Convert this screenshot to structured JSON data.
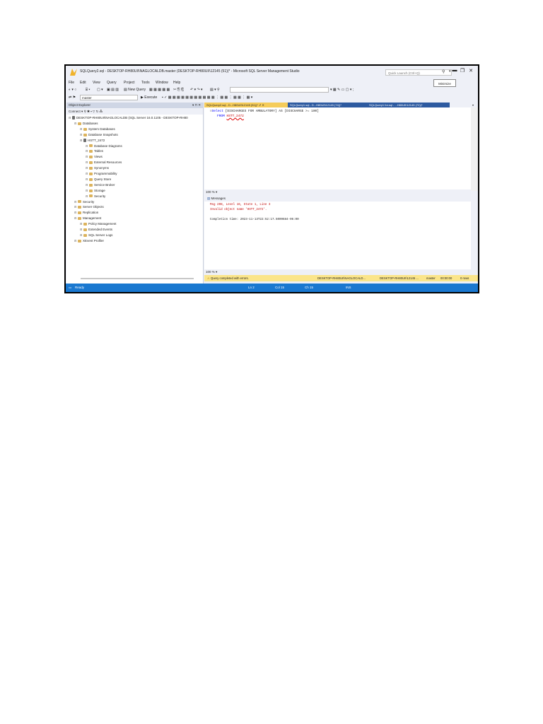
{
  "window": {
    "title": "SQLQuery2.sql - DESKTOP-RH80UII\\NAGLOCALDB.master (DESKTOP-RH80UII\\12145 (51))* - Microsoft SQL Server Management Studio",
    "quick_launch_placeholder": "Quick Launch (Ctrl+Q)",
    "minimize_tooltip": "Minimize"
  },
  "menu": [
    "File",
    "Edit",
    "View",
    "Query",
    "Project",
    "Tools",
    "Window",
    "Help"
  ],
  "toolbar": {
    "new_query": "New Query",
    "database": "master",
    "execute": "Execute"
  },
  "object_explorer": {
    "title": "Object Explorer",
    "title_controls": "▾ ⊓ ✕",
    "toolbar": "Connect ▾  ⚲  ✱  ▪  ▽  ↻  ⁂",
    "tree": [
      {
        "label": "DESKTOP-RH80UII\\NAGLOCALDB (SQL Server 16.0.1105 - DESKTOP-RH80",
        "level": 0,
        "kind": "server"
      },
      {
        "label": "Databases",
        "level": 1,
        "kind": "folder"
      },
      {
        "label": "System Databases",
        "level": 2,
        "kind": "folder"
      },
      {
        "label": "Database Snapshots",
        "level": 2,
        "kind": "folder"
      },
      {
        "label": "HSTT_2472",
        "level": 2,
        "kind": "db"
      },
      {
        "label": "Database Diagrams",
        "level": 3,
        "kind": "folder"
      },
      {
        "label": "Tables",
        "level": 3,
        "kind": "folder"
      },
      {
        "label": "Views",
        "level": 3,
        "kind": "folder"
      },
      {
        "label": "External Resources",
        "level": 3,
        "kind": "folder"
      },
      {
        "label": "Synonyms",
        "level": 3,
        "kind": "folder"
      },
      {
        "label": "Programmability",
        "level": 3,
        "kind": "folder"
      },
      {
        "label": "Query Store",
        "level": 3,
        "kind": "folder"
      },
      {
        "label": "Service Broker",
        "level": 3,
        "kind": "folder"
      },
      {
        "label": "Storage",
        "level": 3,
        "kind": "folder"
      },
      {
        "label": "Security",
        "level": 3,
        "kind": "folder"
      },
      {
        "label": "Security",
        "level": 1,
        "kind": "folder"
      },
      {
        "label": "Server Objects",
        "level": 1,
        "kind": "folder"
      },
      {
        "label": "Replication",
        "level": 1,
        "kind": "folder"
      },
      {
        "label": "Management",
        "level": 1,
        "kind": "folder"
      },
      {
        "label": "Policy Management",
        "level": 2,
        "kind": "folder"
      },
      {
        "label": "Extended Events",
        "level": 2,
        "kind": "folder"
      },
      {
        "label": "SQL Server Logs",
        "level": 2,
        "kind": "folder"
      },
      {
        "label": "XEvent Profiler",
        "level": 1,
        "kind": "folder"
      }
    ]
  },
  "tabs": [
    {
      "label": "SQLQuery2.sql - D...H80UII\\12145 (51))*",
      "active": true,
      "close": "⇗ ✕"
    },
    {
      "label": "SQLQuery1.sql - D...H80UII\\12145 (74))*",
      "active": false
    },
    {
      "label": "SQLQuery1 for.sql - ...H80UII\\12145 (72))*",
      "active": false
    }
  ],
  "editor": {
    "line1_keyword": "Select",
    "line1_rest": "[DISCHARGES FOR AMBULATORY] AS [DISCHARGE >= 100]",
    "line2_keyword": "FROM",
    "line2_table": "HSTT_2472"
  },
  "zoom": "100 %",
  "messages": {
    "header": "Messages",
    "error_line1": "Msg 208, Level 16, State 1, Line 3",
    "error_line2": "Invalid object name 'HSTT_2472'.",
    "completion": "Completion time: 2023-11-13T22:52:17.5009684-06:00"
  },
  "query_status": {
    "text": "Query completed with errors.",
    "server": "DESKTOP-RH80UII\\NAGLOCALD...",
    "user": "DESKTOP-RH80UII\\12145 ...",
    "database": "master",
    "elapsed": "00:00:00",
    "rows": "0 rows"
  },
  "status_bar": {
    "ready": "Ready",
    "ln": "Ln 2",
    "col": "Col 15",
    "ch": "Ch 15",
    "mode": "INS"
  },
  "colors": {
    "accent_blue": "#1a78d0",
    "tab_active": "#f5cc5a",
    "tab_inactive": "#2d5aa0",
    "status_warning": "#fbe58a",
    "error_red": "#c00000"
  }
}
